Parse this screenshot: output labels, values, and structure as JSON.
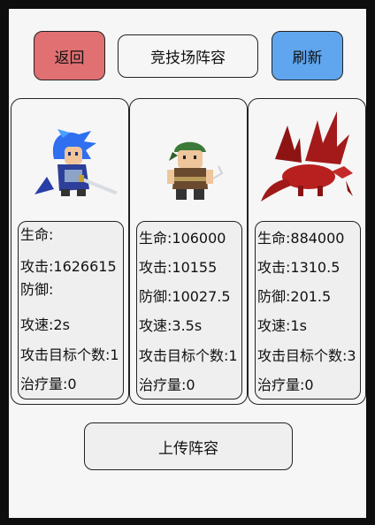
{
  "header": {
    "back_label": "返回",
    "title": "竞技场阵容",
    "refresh_label": "刷新"
  },
  "colors": {
    "back_button": "#e07072",
    "refresh_button": "#5fa6ef"
  },
  "cards": [
    {
      "sprite": "blue-haired-swordsman",
      "stats": {
        "hp": "生命:",
        "atk": "攻击:1626615",
        "def": "防御:",
        "spd": "攻速:2s",
        "targets": "攻击目标个数:1",
        "heal": "治疗量:0"
      }
    },
    {
      "sprite": "green-bandana-fighter",
      "stats": {
        "hp": "生命:106000",
        "atk": "攻击:10155",
        "def": "防御:10027.5",
        "spd": "攻速:3.5s",
        "targets": "攻击目标个数:1",
        "heal": "治疗量:0"
      }
    },
    {
      "sprite": "red-dragon",
      "stats": {
        "hp": "生命:884000",
        "atk": "攻击:1310.5",
        "def": "防御:201.5",
        "spd": "攻速:1s",
        "targets": "攻击目标个数:3",
        "heal": "治疗量:0"
      }
    }
  ],
  "footer": {
    "upload_label": "上传阵容"
  }
}
